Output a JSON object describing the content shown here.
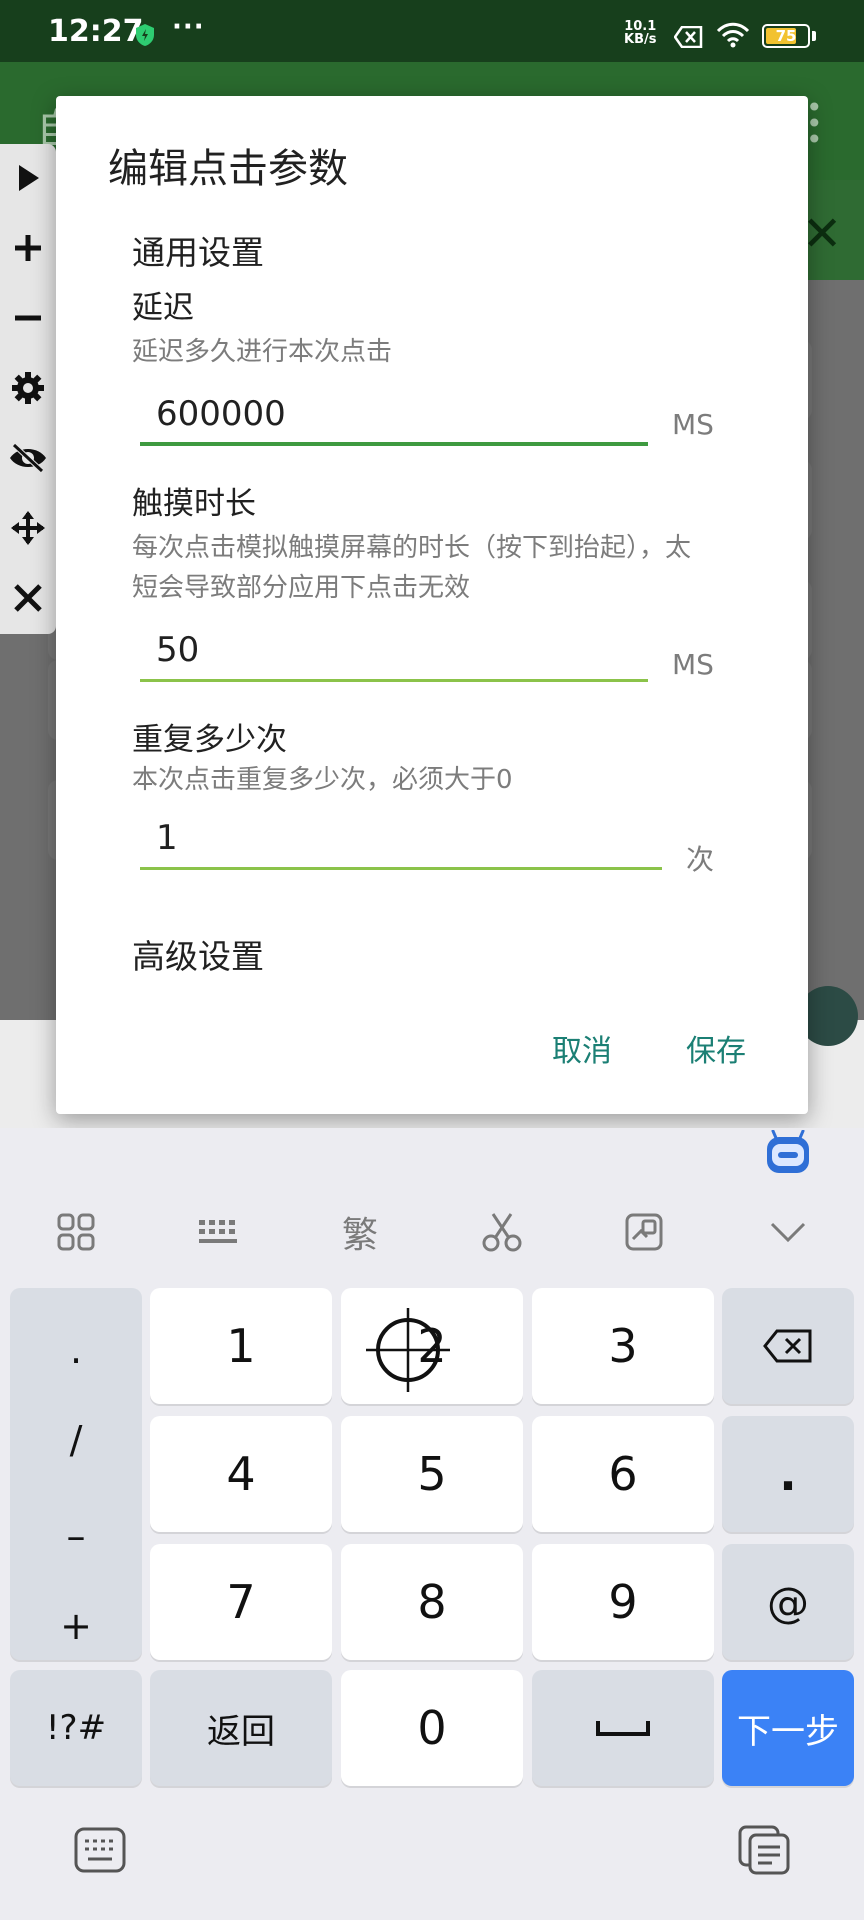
{
  "status_bar": {
    "time": "12:27",
    "more": "···",
    "net_speed_value": "10.1",
    "net_speed_unit": "KB/s",
    "battery": "75",
    "battery_level": 0.75
  },
  "app": {
    "title_partial": "自"
  },
  "floating_toolbar": {
    "icons": [
      "play-icon",
      "plus-icon",
      "minus-icon",
      "gear-icon",
      "eye-off-icon",
      "move-icon",
      "close-icon"
    ]
  },
  "dialog": {
    "title": "编辑点击参数",
    "general_section": "通用设置",
    "advanced_section": "高级设置",
    "fields": [
      {
        "label": "延迟",
        "description": "延迟多久进行本次点击",
        "value": "600000",
        "unit": "MS"
      },
      {
        "label": "触摸时长",
        "description": "每次点击模拟触摸屏幕的时长（按下到抬起），太短会导致部分应用下点击无效",
        "value": "50",
        "unit": "MS"
      },
      {
        "label": "重复多少次",
        "description": "本次点击重复多少次，必须大于0",
        "value": "1",
        "unit": "次"
      }
    ],
    "cancel_label": "取消",
    "save_label": "保存",
    "accent_color": "#1b7f74",
    "input_line_color": "#8bc34a"
  },
  "keyboard": {
    "toolbar_icons": [
      "grid-icon",
      "keyboard-icon",
      "traditional-chinese-icon",
      "scissors-icon",
      "clipboard-icon",
      "chevron-down-icon"
    ],
    "traditional_label": "繁",
    "symbols": [
      ".",
      "/",
      "–",
      "+"
    ],
    "digits": [
      "1",
      "2",
      "3",
      "4",
      "5",
      "6",
      "7",
      "8",
      "9",
      "0"
    ],
    "dot_key": ".",
    "at_key": "@",
    "special_key": "!?#",
    "back_key": "返回",
    "next_key": "下一步",
    "next_key_color": "#3b82f6"
  }
}
